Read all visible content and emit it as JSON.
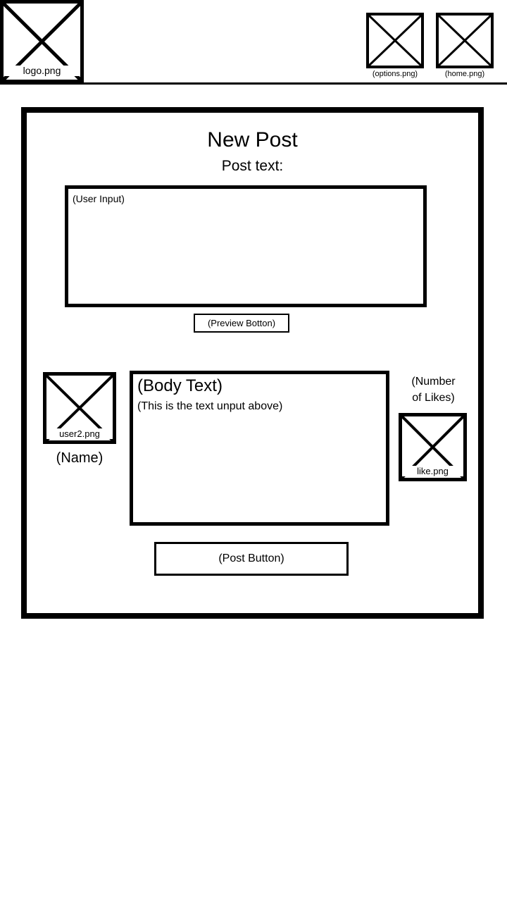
{
  "header": {
    "logo_caption": "logo.png",
    "options_caption": "(options.png)",
    "home_caption": "(home.png)"
  },
  "new_post": {
    "title": "New Post",
    "subtitle": "Post text:",
    "input_placeholder": "(User Input)",
    "preview_button": "(Preview Botton)"
  },
  "preview": {
    "avatar_caption": "user2.png",
    "name": "(Name)",
    "body_title": "(Body Text)",
    "body_text": "(This is the text unput above)",
    "likes_line1": "(Number",
    "likes_line2": "of Likes)",
    "like_caption": "like.png"
  },
  "post_button": "(Post Button)"
}
